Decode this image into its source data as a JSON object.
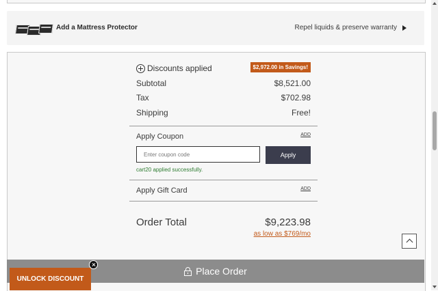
{
  "protector": {
    "label": "Add a Mattress Protector",
    "description": "Repel liquids & preserve warranty"
  },
  "summary": {
    "discounts_label": "Discounts applied",
    "savings_badge": "$2,972.00 in Savings!",
    "lines": [
      {
        "label": "Subtotal",
        "value": "$8,521.00"
      },
      {
        "label": "Tax",
        "value": "$702.98"
      },
      {
        "label": "Shipping",
        "value": "Free!"
      }
    ],
    "coupon": {
      "label": "Apply Coupon",
      "add_link": "ADD",
      "placeholder": "Enter coupon code",
      "apply_label": "Apply",
      "success_message": "cart20 applied successfully."
    },
    "gift_card": {
      "label": "Apply Gift Card",
      "add_link": "ADD"
    },
    "total": {
      "label": "Order Total",
      "value": "$9,223.98",
      "financing": "as low as $769/mo"
    }
  },
  "place_order_label": "Place Order",
  "unlock_discount_label": "UNLOCK DISCOUNT",
  "colors": {
    "accent": "#c25a1a",
    "button_dark": "#3b3d4d",
    "success": "#2f7d32",
    "place_order_bg": "#8c8c8c"
  },
  "icons": [
    "plus-circle-icon",
    "lock-icon",
    "chevron-right-icon",
    "chevron-up-icon",
    "close-icon"
  ]
}
